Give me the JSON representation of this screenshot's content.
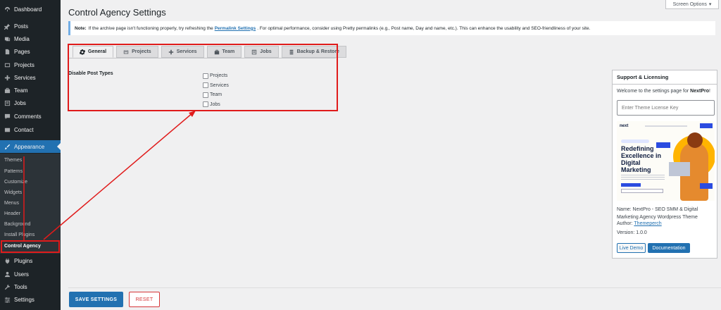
{
  "sidebar": {
    "items": [
      {
        "label": "Dashboard",
        "icon": "dashboard-icon"
      },
      {
        "label": "Posts",
        "icon": "pin-icon"
      },
      {
        "label": "Media",
        "icon": "media-icon"
      },
      {
        "label": "Pages",
        "icon": "page-icon"
      },
      {
        "label": "Projects",
        "icon": "projects-icon"
      },
      {
        "label": "Services",
        "icon": "services-icon"
      },
      {
        "label": "Team",
        "icon": "team-icon"
      },
      {
        "label": "Jobs",
        "icon": "jobs-icon"
      },
      {
        "label": "Comments",
        "icon": "comment-icon"
      },
      {
        "label": "Contact",
        "icon": "mail-icon"
      },
      {
        "label": "Appearance",
        "icon": "brush-icon"
      },
      {
        "label": "Plugins",
        "icon": "plugin-icon"
      },
      {
        "label": "Users",
        "icon": "user-icon"
      },
      {
        "label": "Tools",
        "icon": "wrench-icon"
      },
      {
        "label": "Settings",
        "icon": "settings-icon"
      }
    ],
    "submenu": [
      "Themes",
      "Patterns",
      "Customize",
      "Widgets",
      "Menus",
      "Header",
      "Background",
      "Install Plugins",
      "Control Agency"
    ]
  },
  "header": {
    "title": "Control Agency Settings",
    "screen_options": "Screen Options"
  },
  "notice": {
    "label": "Note:",
    "text_before": "If the archive page isn't functioning properly, try refreshing the",
    "link": "Permalink Settings",
    "text_after": ". For optimal performance, consider using Pretty permalinks (e.g., Post name, Day and name, etc.). This can enhance the usability and SEO-friendliness of your site."
  },
  "tabs": [
    {
      "label": "General",
      "icon": "gear-icon"
    },
    {
      "label": "Projects",
      "icon": "projects-icon"
    },
    {
      "label": "Services",
      "icon": "services-icon"
    },
    {
      "label": "Team",
      "icon": "team-icon"
    },
    {
      "label": "Jobs",
      "icon": "jobs-icon"
    },
    {
      "label": "Backup & Restore",
      "icon": "database-icon"
    }
  ],
  "general": {
    "field_label": "Disable Post Types",
    "options": [
      "Projects",
      "Services",
      "Team",
      "Jobs"
    ]
  },
  "support": {
    "title": "Support & Licensing",
    "welcome_prefix": "Welcome to the settings page for",
    "theme": "NextPro",
    "welcome_suffix": "!",
    "license_placeholder": "Enter Theme License Key",
    "preview": {
      "logo": "next",
      "headline": "Redefining Excellence in Digital Marketing"
    },
    "name": "Name: NextPro - SEO SMM & Digital Marketing Agency Wordpress Theme",
    "author_label": "Author:",
    "author": "Themeperch",
    "version": "Version: 1.0.0",
    "live_demo": "Live Demo",
    "documentation": "Documentation"
  },
  "footer": {
    "save": "SAVE SETTINGS",
    "reset": "RESET"
  },
  "colors": {
    "accent": "#2271b1",
    "sidebar": "#1d2327",
    "annotation": "#e01b1b",
    "reset": "#d63638"
  }
}
